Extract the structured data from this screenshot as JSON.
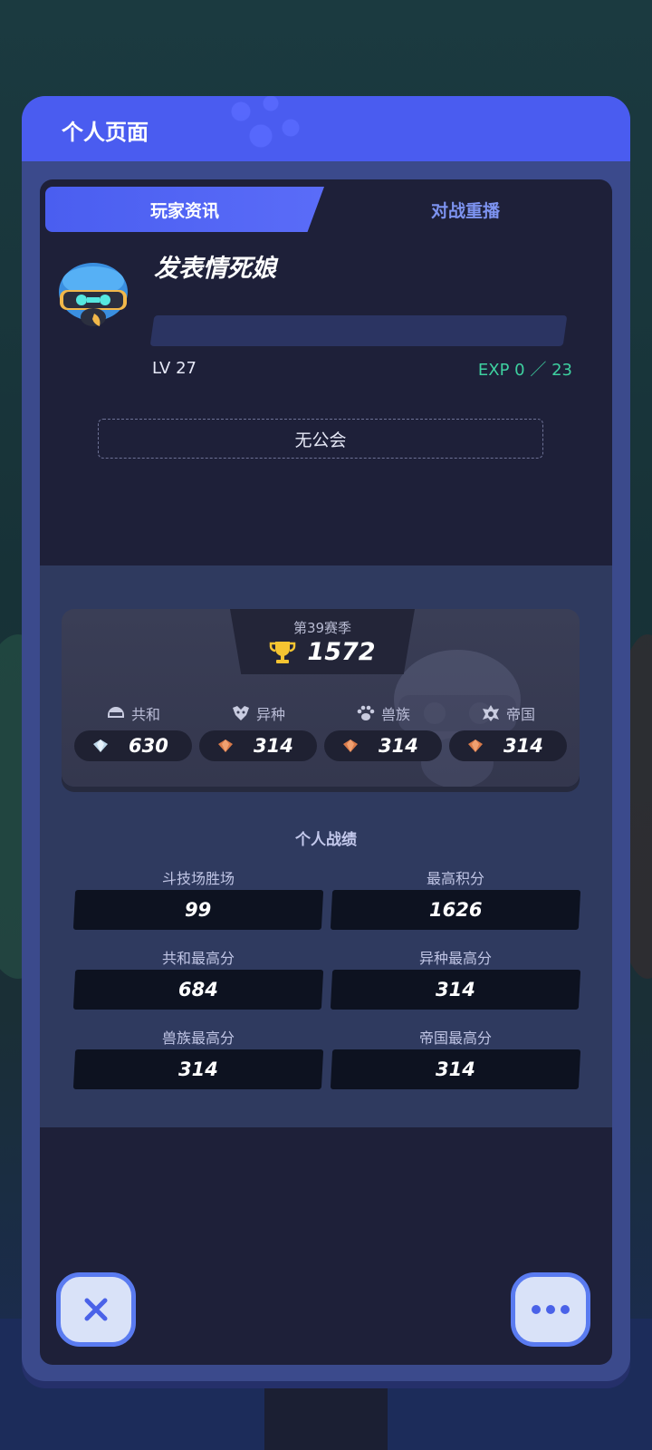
{
  "modal": {
    "title": "个人页面",
    "tabs": [
      {
        "label": "玩家资讯",
        "active": true
      },
      {
        "label": "对战重播",
        "active": false
      }
    ]
  },
  "player": {
    "name": "发表情死娘",
    "level": "LV 27",
    "exp": "EXP 0 ／ 23",
    "guild": "无公会"
  },
  "season": {
    "label": "第39赛季",
    "score": "1572",
    "factions": [
      {
        "name": "共和",
        "icon": "helmet-icon",
        "gem": "diamond-gem-icon",
        "value": "630"
      },
      {
        "name": "异种",
        "icon": "alien-icon",
        "gem": "bronze-gem-icon",
        "value": "314"
      },
      {
        "name": "兽族",
        "icon": "paw-icon",
        "gem": "bronze-gem-icon",
        "value": "314"
      },
      {
        "name": "帝国",
        "icon": "empire-icon",
        "gem": "bronze-gem-icon",
        "value": "314"
      }
    ]
  },
  "stats": {
    "title": "个人战绩",
    "items": [
      {
        "label": "斗技场胜场",
        "value": "99"
      },
      {
        "label": "最高积分",
        "value": "1626"
      },
      {
        "label": "共和最高分",
        "value": "684"
      },
      {
        "label": "异种最高分",
        "value": "314"
      },
      {
        "label": "兽族最高分",
        "value": "314"
      },
      {
        "label": "帝国最高分",
        "value": "314"
      }
    ]
  },
  "buttons": {
    "close_icon": "close-icon",
    "more_icon": "more-icon"
  },
  "colors": {
    "accent": "#4a5cf0",
    "exp": "#3ed0a0",
    "panel": "#1e2039"
  }
}
